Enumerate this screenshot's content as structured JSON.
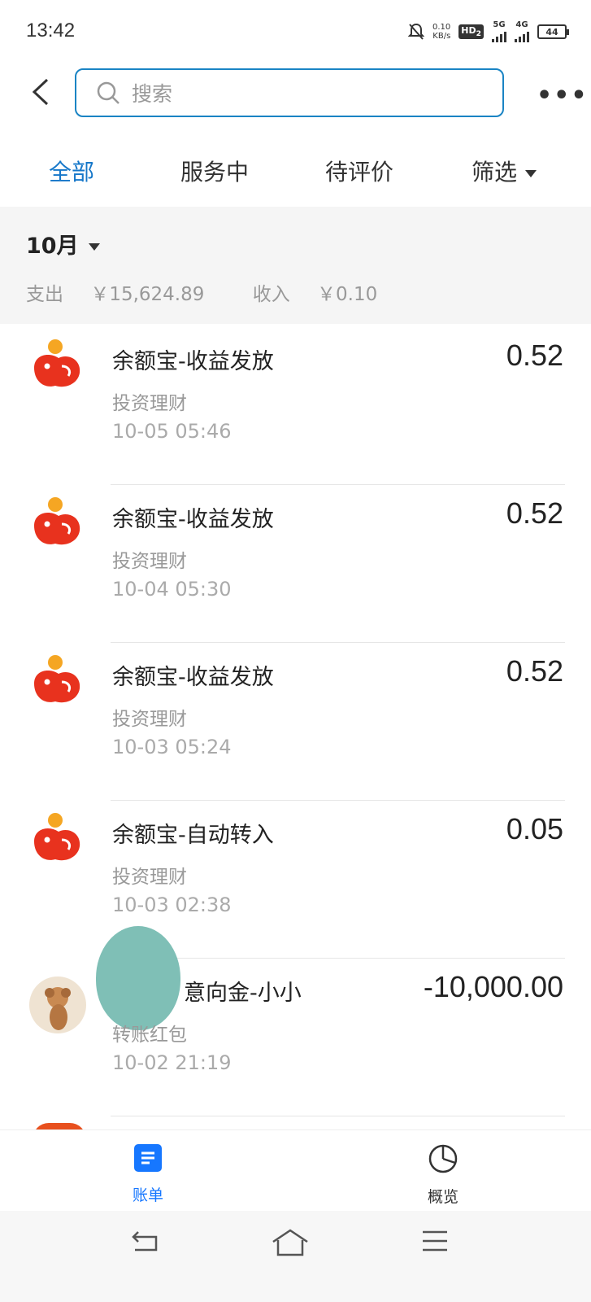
{
  "status_bar": {
    "time": "13:42",
    "net_speed_value": "0.10",
    "net_speed_unit": "KB/s",
    "hd_label": "HD",
    "sim_number": "2",
    "signal1_label": "5G",
    "signal2_label": "4G",
    "battery": "44"
  },
  "header": {
    "search_placeholder": "搜索",
    "more_label": "•••"
  },
  "tabs": [
    {
      "label": "全部",
      "active": true
    },
    {
      "label": "服务中",
      "active": false
    },
    {
      "label": "待评价",
      "active": false
    },
    {
      "label": "筛选",
      "active": false
    }
  ],
  "month": {
    "label": "10月",
    "expense_label": "支出",
    "expense_value": "￥15,624.89",
    "income_label": "收入",
    "income_value": "￥0.10"
  },
  "transactions": [
    {
      "title": "余额宝-收益发放",
      "category": "投资理财",
      "time": "10-05  05:46",
      "amount": "0.52",
      "icon": "yuebao-icon"
    },
    {
      "title": "余额宝-收益发放",
      "category": "投资理财",
      "time": "10-04  05:30",
      "amount": "0.52",
      "icon": "yuebao-icon"
    },
    {
      "title": "余额宝-收益发放",
      "category": "投资理财",
      "time": "10-03  05:24",
      "amount": "0.52",
      "icon": "yuebao-icon"
    },
    {
      "title": "余额宝-自动转入",
      "category": "投资理财",
      "time": "10-03  02:38",
      "amount": "0.05",
      "icon": "yuebao-icon"
    },
    {
      "title": "意向金-小小",
      "category": "转账红包",
      "time": "10-02  21:19",
      "amount": "-10,000.00",
      "icon": "avatar"
    }
  ],
  "bottom_nav": [
    {
      "label": "账单",
      "active": true,
      "icon": "bill-icon"
    },
    {
      "label": "概览",
      "active": false,
      "icon": "pie-chart-icon"
    }
  ],
  "colors": {
    "accent": "#1677c9",
    "nav_active": "#1677ff",
    "yuebao_red": "#e8321e",
    "yuebao_orange": "#f5a623"
  }
}
